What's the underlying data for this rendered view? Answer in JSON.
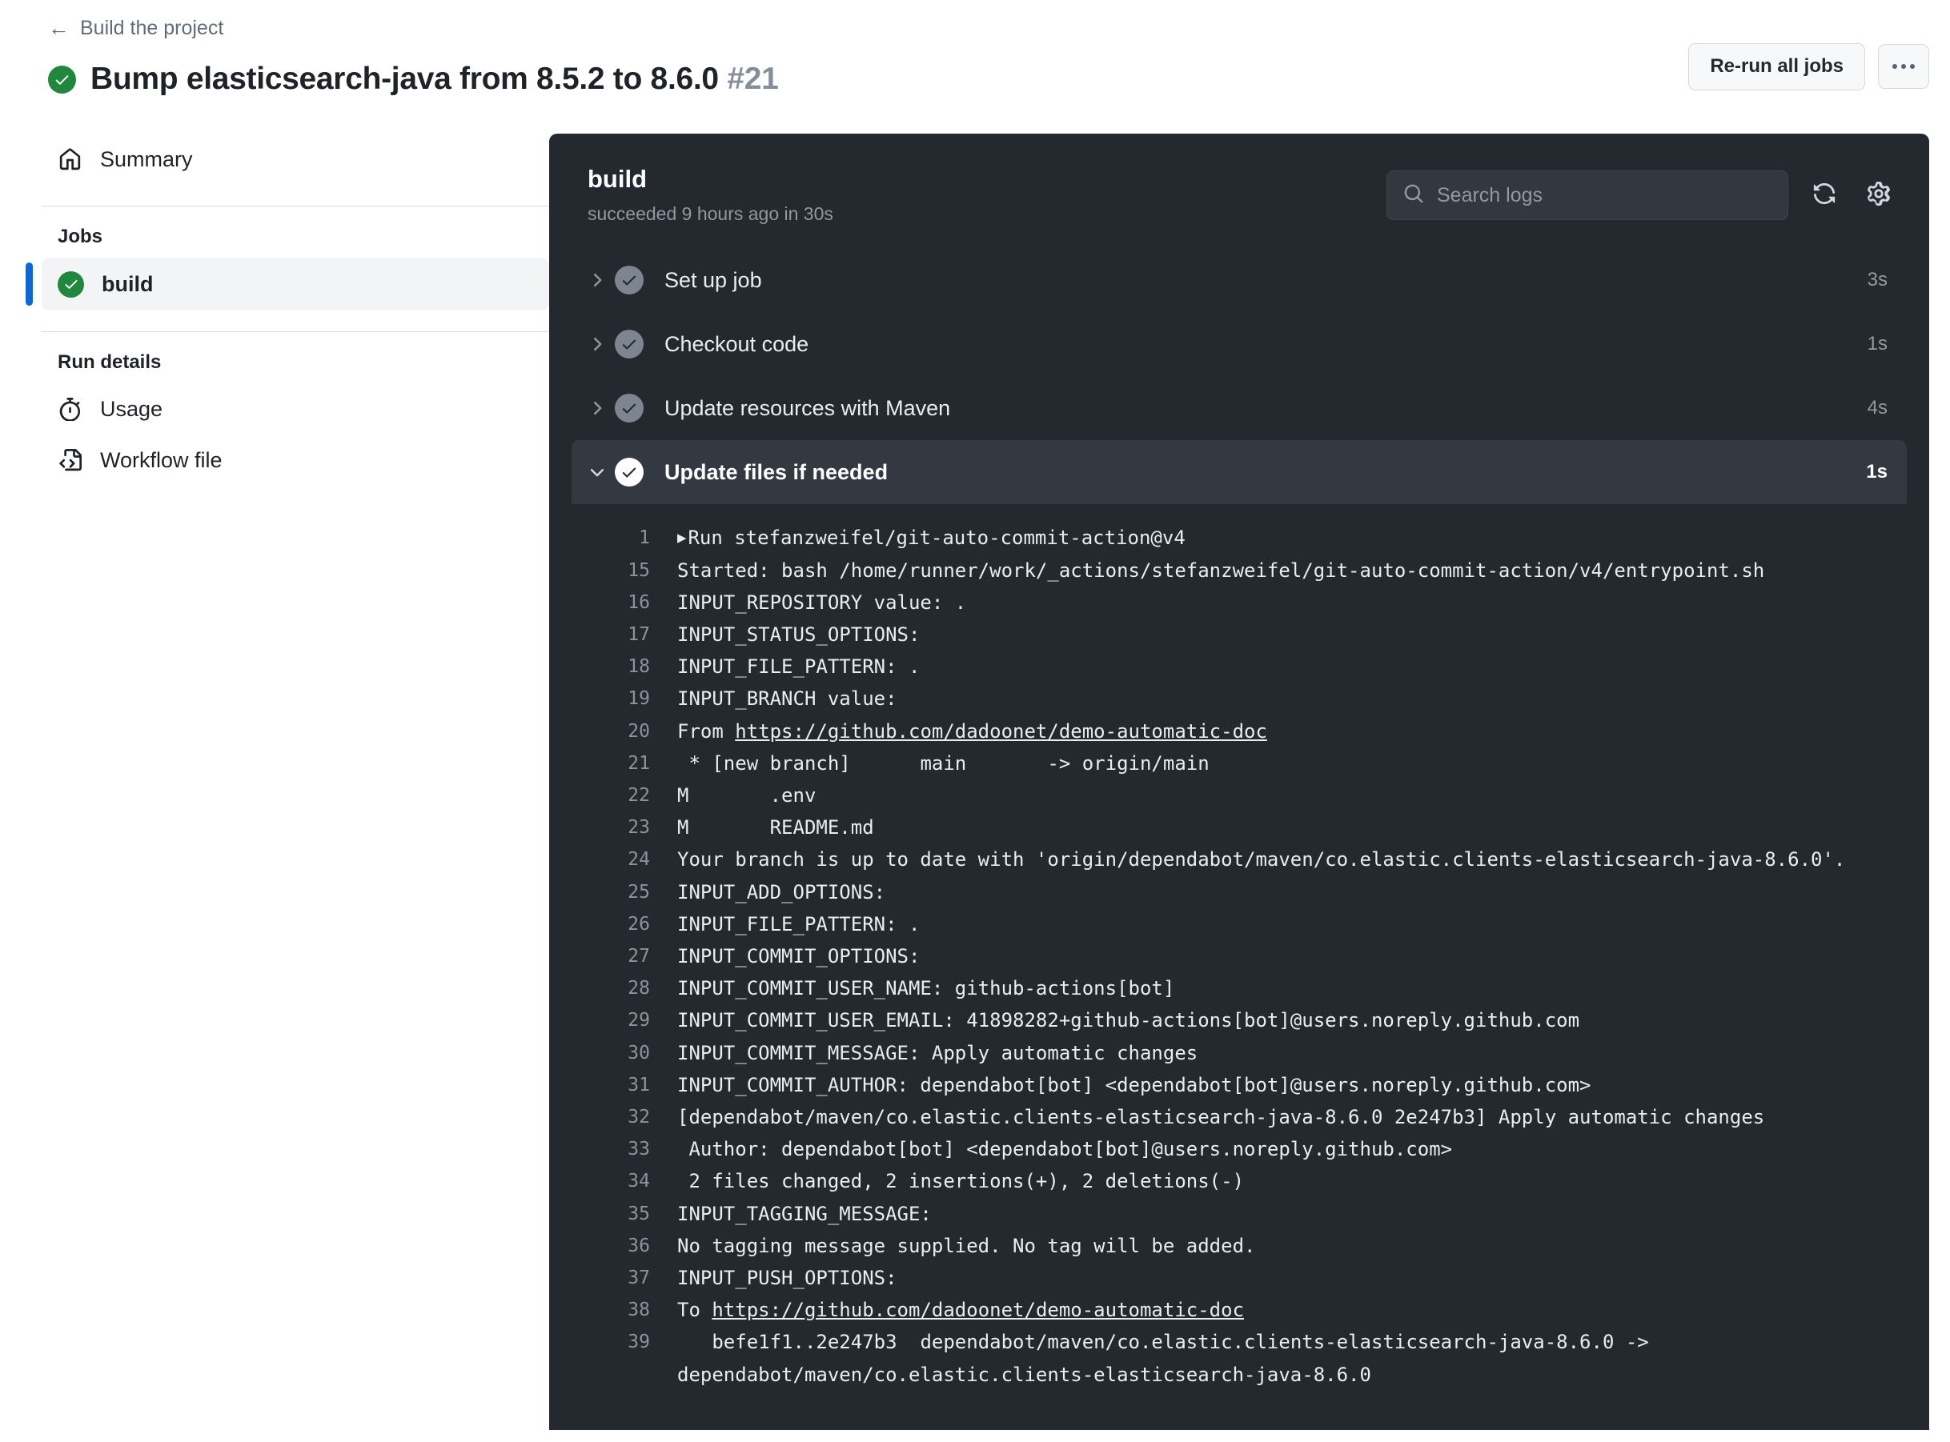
{
  "header": {
    "back_label": "Build the project",
    "back_icon": "arrow-left-icon",
    "status_icon": "check-circle-icon",
    "run_title": "Bump elasticsearch-java from 8.5.2 to 8.6.0",
    "run_number": "#21",
    "rerun_button": "Re-run all jobs",
    "more_button_icon": "kebab-horizontal-icon"
  },
  "sidebar": {
    "summary": {
      "label": "Summary",
      "icon": "home-icon"
    },
    "jobs_heading": "Jobs",
    "jobs": [
      {
        "label": "build",
        "status": "success",
        "icon": "check-circle-icon",
        "selected": true
      }
    ],
    "run_details_heading": "Run details",
    "run_details": [
      {
        "label": "Usage",
        "icon": "stopwatch-icon"
      },
      {
        "label": "Workflow file",
        "icon": "file-code-icon"
      }
    ]
  },
  "log_panel": {
    "title": "build",
    "subtitle": "succeeded 9 hours ago in 30s",
    "search": {
      "placeholder": "Search logs",
      "value": "",
      "icon": "search-icon"
    },
    "refresh_icon": "sync-icon",
    "settings_icon": "gear-icon",
    "steps": [
      {
        "name": "Set up job",
        "duration": "3s",
        "expanded": false,
        "status": "success"
      },
      {
        "name": "Checkout code",
        "duration": "1s",
        "expanded": false,
        "status": "success"
      },
      {
        "name": "Update resources with Maven",
        "duration": "4s",
        "expanded": false,
        "status": "success"
      },
      {
        "name": "Update files if needed",
        "duration": "1s",
        "expanded": true,
        "status": "success"
      }
    ],
    "lines": [
      {
        "num": "1",
        "prefix_caret": true,
        "text": "Run stefanzweifel/git-auto-commit-action@v4"
      },
      {
        "num": "15",
        "text": "Started: bash /home/runner/work/_actions/stefanzweifel/git-auto-commit-action/v4/entrypoint.sh"
      },
      {
        "num": "16",
        "text": "INPUT_REPOSITORY value: ."
      },
      {
        "num": "17",
        "text": "INPUT_STATUS_OPTIONS:"
      },
      {
        "num": "18",
        "text": "INPUT_FILE_PATTERN: ."
      },
      {
        "num": "19",
        "text": "INPUT_BRANCH value:"
      },
      {
        "num": "20",
        "text": "From ",
        "link": "https://github.com/dadoonet/demo-automatic-doc"
      },
      {
        "num": "21",
        "text": " * [new branch]      main       -> origin/main"
      },
      {
        "num": "22",
        "text": "M\t.env"
      },
      {
        "num": "23",
        "text": "M\tREADME.md"
      },
      {
        "num": "24",
        "text": "Your branch is up to date with 'origin/dependabot/maven/co.elastic.clients-elasticsearch-java-8.6.0'."
      },
      {
        "num": "25",
        "text": "INPUT_ADD_OPTIONS:"
      },
      {
        "num": "26",
        "text": "INPUT_FILE_PATTERN: ."
      },
      {
        "num": "27",
        "text": "INPUT_COMMIT_OPTIONS:"
      },
      {
        "num": "28",
        "text": "INPUT_COMMIT_USER_NAME: github-actions[bot]"
      },
      {
        "num": "29",
        "text": "INPUT_COMMIT_USER_EMAIL: 41898282+github-actions[bot]@users.noreply.github.com"
      },
      {
        "num": "30",
        "text": "INPUT_COMMIT_MESSAGE: Apply automatic changes"
      },
      {
        "num": "31",
        "text": "INPUT_COMMIT_AUTHOR: dependabot[bot] <dependabot[bot]@users.noreply.github.com>"
      },
      {
        "num": "32",
        "text": "[dependabot/maven/co.elastic.clients-elasticsearch-java-8.6.0 2e247b3] Apply automatic changes"
      },
      {
        "num": "33",
        "text": " Author: dependabot[bot] <dependabot[bot]@users.noreply.github.com>"
      },
      {
        "num": "34",
        "text": " 2 files changed, 2 insertions(+), 2 deletions(-)"
      },
      {
        "num": "35",
        "text": "INPUT_TAGGING_MESSAGE:"
      },
      {
        "num": "36",
        "text": "No tagging message supplied. No tag will be added."
      },
      {
        "num": "37",
        "text": "INPUT_PUSH_OPTIONS:"
      },
      {
        "num": "38",
        "text": "To ",
        "link": "https://github.com/dadoonet/demo-automatic-doc"
      },
      {
        "num": "39",
        "text": "   befe1f1..2e247b3  dependabot/maven/co.elastic.clients-elasticsearch-java-8.6.0 -> dependabot/maven/co.elastic.clients-elasticsearch-java-8.6.0"
      }
    ]
  },
  "colors": {
    "success_green": "#1f883d",
    "accent_blue": "#0969da",
    "panel_bg": "#24292f",
    "panel_row_active": "#343941",
    "log_text": "#e6edf3",
    "muted": "#9198a1"
  }
}
